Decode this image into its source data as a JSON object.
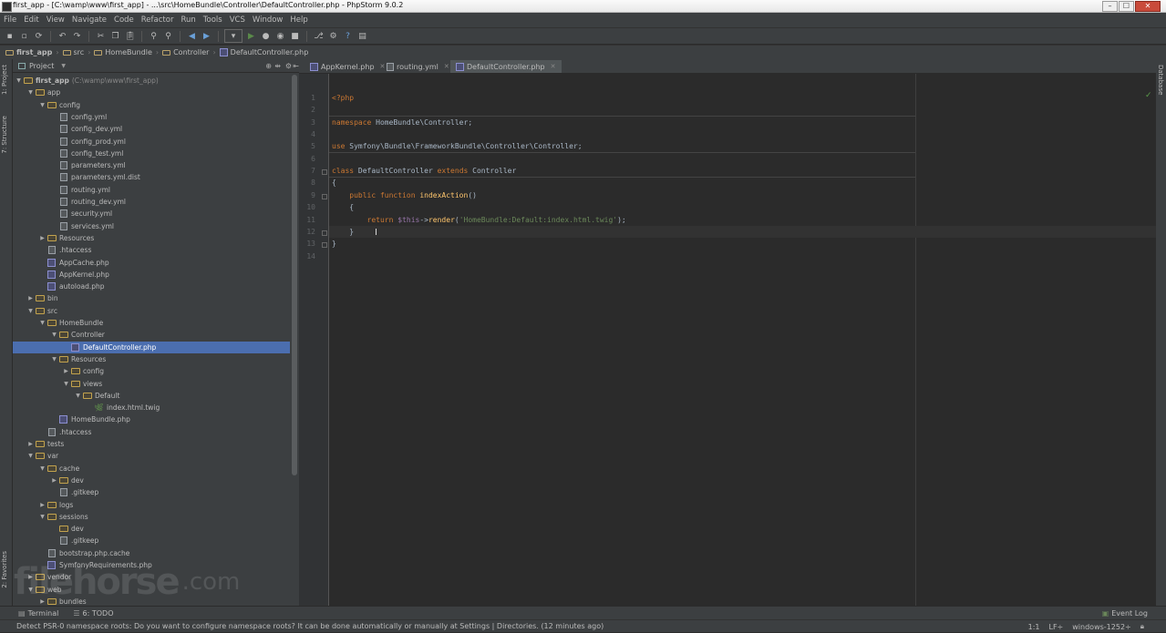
{
  "window": {
    "title": "first_app - [C:\\wamp\\www\\first_app] - ...\\src\\HomeBundle\\Controller\\DefaultController.php - PhpStorm 9.0.2",
    "min": "–",
    "max": "☐",
    "close": "✕"
  },
  "menu": [
    "File",
    "Edit",
    "View",
    "Navigate",
    "Code",
    "Refactor",
    "Run",
    "Tools",
    "VCS",
    "Window",
    "Help"
  ],
  "toolbar": {
    "icons": [
      "save-icon",
      "save-all-icon",
      "sync-icon",
      "undo-icon",
      "redo-icon",
      "cut-icon",
      "copy-icon",
      "paste-icon",
      "find-icon",
      "replace-icon",
      "back-icon",
      "forward-icon",
      "run-config-dropdown-icon",
      "run-icon",
      "debug-icon",
      "coverage-icon",
      "stop-icon",
      "vcs-icon",
      "settings-icon",
      "help-icon",
      "terminal-icon"
    ]
  },
  "breadcrumb": [
    "first_app",
    "src",
    "HomeBundle",
    "Controller",
    "DefaultController.php"
  ],
  "left_stripe": {
    "project": "1: Project",
    "structure": "7: Structure",
    "favorites": "2: Favorites"
  },
  "right_stripe": {
    "database": "Database"
  },
  "project_panel": {
    "title": "Project",
    "root_hint": "(C:\\wamp\\www\\first_app)",
    "tree": [
      {
        "label": "first_app",
        "depth": 0,
        "type": "folder",
        "open": true
      },
      {
        "label": "app",
        "depth": 1,
        "type": "folder",
        "open": true
      },
      {
        "label": "config",
        "depth": 2,
        "type": "folder",
        "open": true
      },
      {
        "label": "config.yml",
        "depth": 3,
        "type": "file"
      },
      {
        "label": "config_dev.yml",
        "depth": 3,
        "type": "file"
      },
      {
        "label": "config_prod.yml",
        "depth": 3,
        "type": "file"
      },
      {
        "label": "config_test.yml",
        "depth": 3,
        "type": "file"
      },
      {
        "label": "parameters.yml",
        "depth": 3,
        "type": "file"
      },
      {
        "label": "parameters.yml.dist",
        "depth": 3,
        "type": "file"
      },
      {
        "label": "routing.yml",
        "depth": 3,
        "type": "file"
      },
      {
        "label": "routing_dev.yml",
        "depth": 3,
        "type": "file"
      },
      {
        "label": "security.yml",
        "depth": 3,
        "type": "file"
      },
      {
        "label": "services.yml",
        "depth": 3,
        "type": "file"
      },
      {
        "label": "Resources",
        "depth": 2,
        "type": "folder",
        "open": false
      },
      {
        "label": ".htaccess",
        "depth": 2,
        "type": "file"
      },
      {
        "label": "AppCache.php",
        "depth": 2,
        "type": "php"
      },
      {
        "label": "AppKernel.php",
        "depth": 2,
        "type": "php"
      },
      {
        "label": "autoload.php",
        "depth": 2,
        "type": "php"
      },
      {
        "label": "bin",
        "depth": 1,
        "type": "folder",
        "open": false
      },
      {
        "label": "src",
        "depth": 1,
        "type": "folder",
        "open": true
      },
      {
        "label": "HomeBundle",
        "depth": 2,
        "type": "folder",
        "open": true
      },
      {
        "label": "Controller",
        "depth": 3,
        "type": "folder",
        "open": true
      },
      {
        "label": "DefaultController.php",
        "depth": 4,
        "type": "php",
        "selected": true
      },
      {
        "label": "Resources",
        "depth": 3,
        "type": "folder",
        "open": true
      },
      {
        "label": "config",
        "depth": 4,
        "type": "folder",
        "open": false
      },
      {
        "label": "views",
        "depth": 4,
        "type": "folder",
        "open": true
      },
      {
        "label": "Default",
        "depth": 5,
        "type": "folder",
        "open": true
      },
      {
        "label": "index.html.twig",
        "depth": 6,
        "type": "twig"
      },
      {
        "label": "HomeBundle.php",
        "depth": 3,
        "type": "php"
      },
      {
        "label": ".htaccess",
        "depth": 2,
        "type": "file"
      },
      {
        "label": "tests",
        "depth": 1,
        "type": "folder",
        "open": false
      },
      {
        "label": "var",
        "depth": 1,
        "type": "folder",
        "open": true
      },
      {
        "label": "cache",
        "depth": 2,
        "type": "folder",
        "open": true
      },
      {
        "label": "dev",
        "depth": 3,
        "type": "folder",
        "open": false
      },
      {
        "label": ".gitkeep",
        "depth": 3,
        "type": "file"
      },
      {
        "label": "logs",
        "depth": 2,
        "type": "folder",
        "open": false
      },
      {
        "label": "sessions",
        "depth": 2,
        "type": "folder",
        "open": true
      },
      {
        "label": "dev",
        "depth": 3,
        "type": "folder"
      },
      {
        "label": ".gitkeep",
        "depth": 3,
        "type": "file"
      },
      {
        "label": "bootstrap.php.cache",
        "depth": 2,
        "type": "file"
      },
      {
        "label": "SymfonyRequirements.php",
        "depth": 2,
        "type": "php"
      },
      {
        "label": "vendor",
        "depth": 1,
        "type": "folder",
        "open": false
      },
      {
        "label": "web",
        "depth": 1,
        "type": "folder",
        "open": true
      },
      {
        "label": "bundles",
        "depth": 2,
        "type": "folder",
        "open": false
      }
    ]
  },
  "tabs": [
    {
      "label": "AppKernel.php",
      "active": false
    },
    {
      "label": "routing.yml",
      "active": false
    },
    {
      "label": "DefaultController.php",
      "active": true
    }
  ],
  "editor": {
    "line_numbers": [
      "1",
      "2",
      "3",
      "4",
      "5",
      "6",
      "7",
      "8",
      "9",
      "10",
      "11",
      "12",
      "13",
      "14"
    ],
    "lines": [
      [
        [
          "kw",
          "<?php"
        ]
      ],
      [],
      [
        [
          "kw",
          "namespace "
        ],
        [
          "t",
          "HomeBundle\\Controller;"
        ]
      ],
      [],
      [
        [
          "kw",
          "use "
        ],
        [
          "t",
          "Symfony\\Bundle\\FrameworkBundle\\Controller\\Controller;"
        ]
      ],
      [],
      [
        [
          "kw",
          "class "
        ],
        [
          "t",
          "DefaultController "
        ],
        [
          "kw",
          "extends "
        ],
        [
          "t",
          "Controller"
        ]
      ],
      [
        [
          "t",
          "{"
        ]
      ],
      [
        [
          "t",
          "    "
        ],
        [
          "kw",
          "public function "
        ],
        [
          "fn",
          "indexAction"
        ],
        [
          "t",
          "()"
        ]
      ],
      [
        [
          "t",
          "    {"
        ]
      ],
      [
        [
          "t",
          "        "
        ],
        [
          "kw",
          "return "
        ],
        [
          "var",
          "$this"
        ],
        [
          "t",
          "->"
        ],
        [
          "fn",
          "render"
        ],
        [
          "t",
          "("
        ],
        [
          "str",
          "'HomeBundle:Default:index.html.twig'"
        ],
        [
          "t",
          ");"
        ]
      ],
      [
        [
          "t",
          "    }"
        ]
      ],
      [
        [
          "t",
          "}"
        ]
      ],
      []
    ]
  },
  "bottom_tools": [
    {
      "label": "Terminal",
      "icon": "terminal-icon"
    },
    {
      "label": "6: TODO",
      "icon": "todo-icon"
    }
  ],
  "event_log": "Event Log",
  "status": {
    "message": "Detect PSR-0 namespace roots: Do you want to configure namespace roots? It can be done automatically or manually at Settings | Directories. (12 minutes ago)",
    "position": "1:1",
    "line_sep": "LF÷",
    "encoding": "windows-1252÷"
  },
  "watermark": {
    "main": "filehorse",
    "suffix": ".com"
  }
}
